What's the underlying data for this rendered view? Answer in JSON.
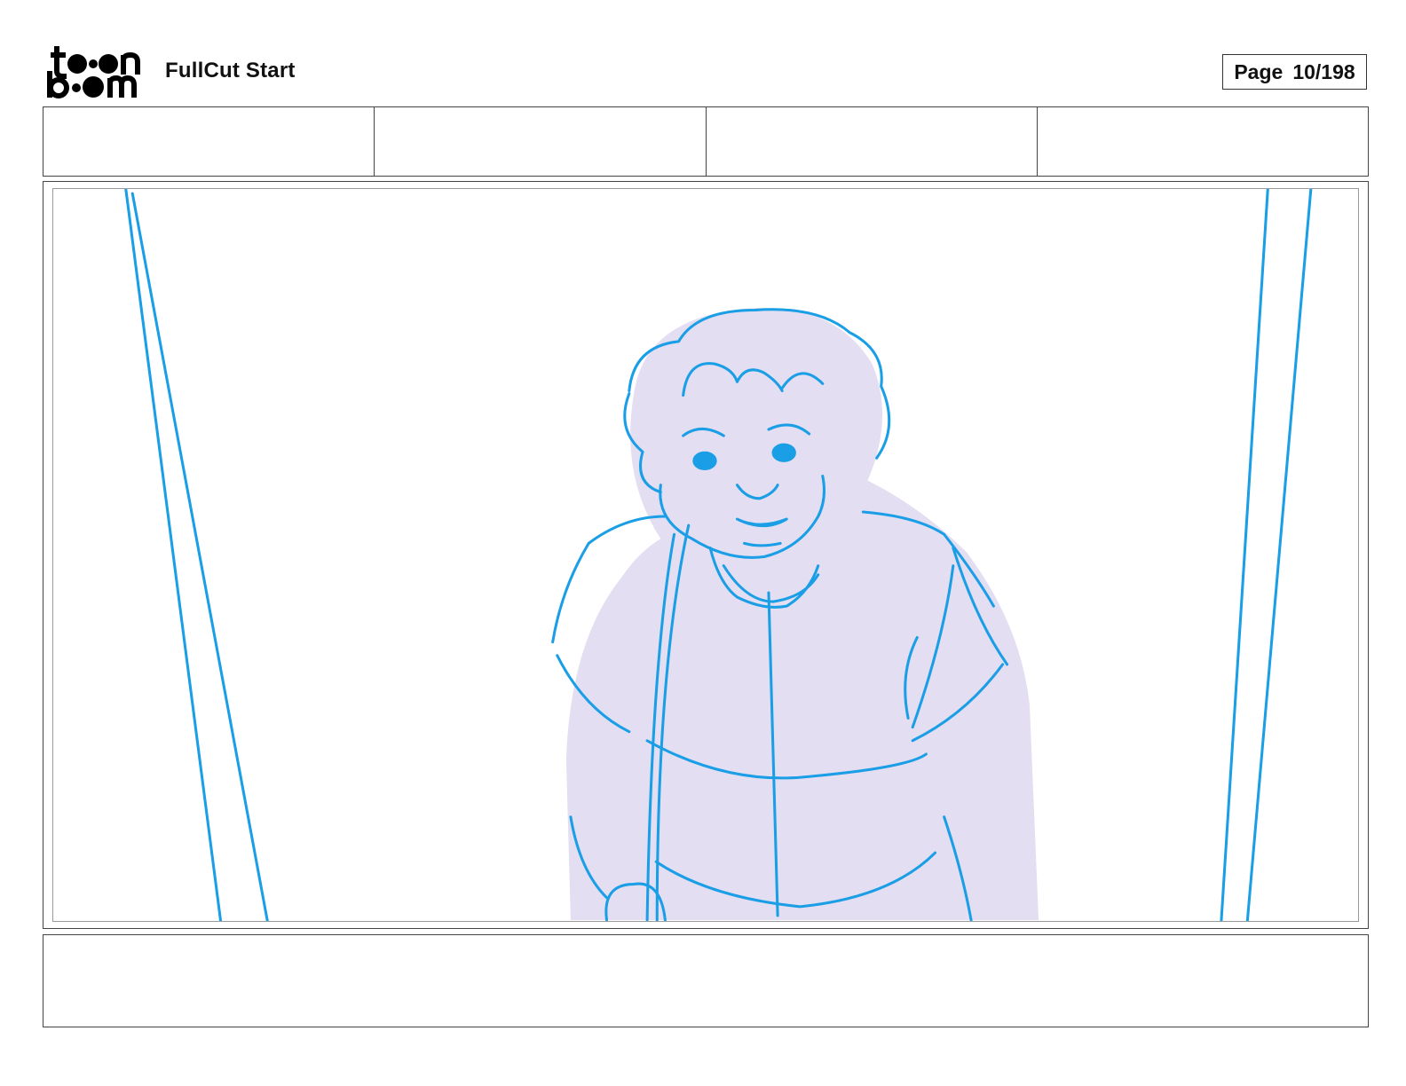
{
  "header": {
    "logo_text": "toonboom",
    "project_title": "FullCut Start",
    "page_label": "Page",
    "page_number": "10/198"
  },
  "info_row": {
    "cells": [
      "",
      "",
      "",
      ""
    ]
  },
  "panel": {
    "sketch_color": "#1a9ee6",
    "shading_color": "#e4def2"
  },
  "notes": {
    "text": ""
  }
}
